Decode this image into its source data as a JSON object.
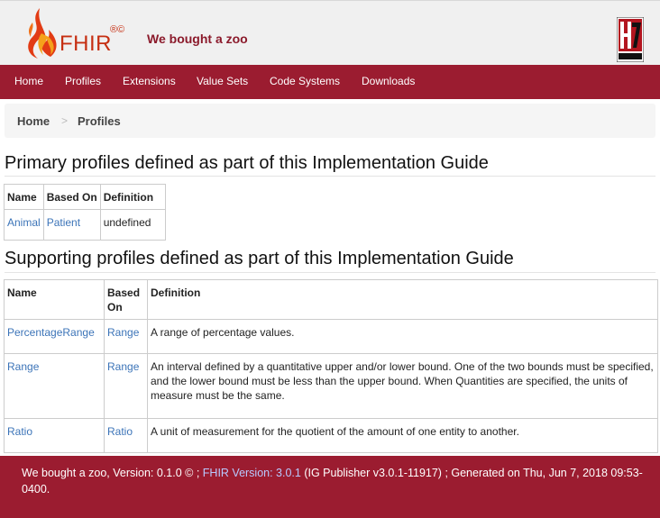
{
  "header": {
    "logo_text": "FHIR",
    "logo_marks": "®©",
    "site_title": "We bought a zoo",
    "hl7_logo": "HL7 International"
  },
  "nav": {
    "items": [
      "Home",
      "Profiles",
      "Extensions",
      "Value Sets",
      "Code Systems",
      "Downloads"
    ]
  },
  "breadcrumb": {
    "items": [
      "Home",
      "Profiles"
    ],
    "separator": ">"
  },
  "primary": {
    "title": "Primary profiles defined as part of this Implementation Guide",
    "columns": [
      "Name",
      "Based On",
      "Definition"
    ],
    "rows": [
      {
        "name": "Animal",
        "based_on": "Patient",
        "definition": "undefined"
      }
    ]
  },
  "supporting": {
    "title": "Supporting profiles defined as part of this Implementation Guide",
    "columns": [
      "Name",
      "Based On",
      "Definition"
    ],
    "rows": [
      {
        "name": "PercentageRange",
        "based_on": "Range",
        "definition": "A range of percentage values."
      },
      {
        "name": "Range",
        "based_on": "Range",
        "definition": "An interval defined by a quantitative upper and/or lower bound. One of the two bounds must be specified, and the lower bound must be less than the upper bound. When Quantities are specified, the units of measure must be the same."
      },
      {
        "name": "Ratio",
        "based_on": "Ratio",
        "definition": "A unit of measurement for the quotient of the amount of one entity to another."
      }
    ]
  },
  "footer": {
    "text_before": "We bought a zoo, Version: 0.1.0 © ;",
    "link_text": "FHIR Version: 3.0.1",
    "text_after": "(IG Publisher v3.0.1-11917) ; Generated on Thu, Jun 7, 2018 09:53-0400."
  },
  "colors": {
    "brand": "#9b1c30",
    "link": "#3c74b8",
    "logo": "#c62f12"
  }
}
